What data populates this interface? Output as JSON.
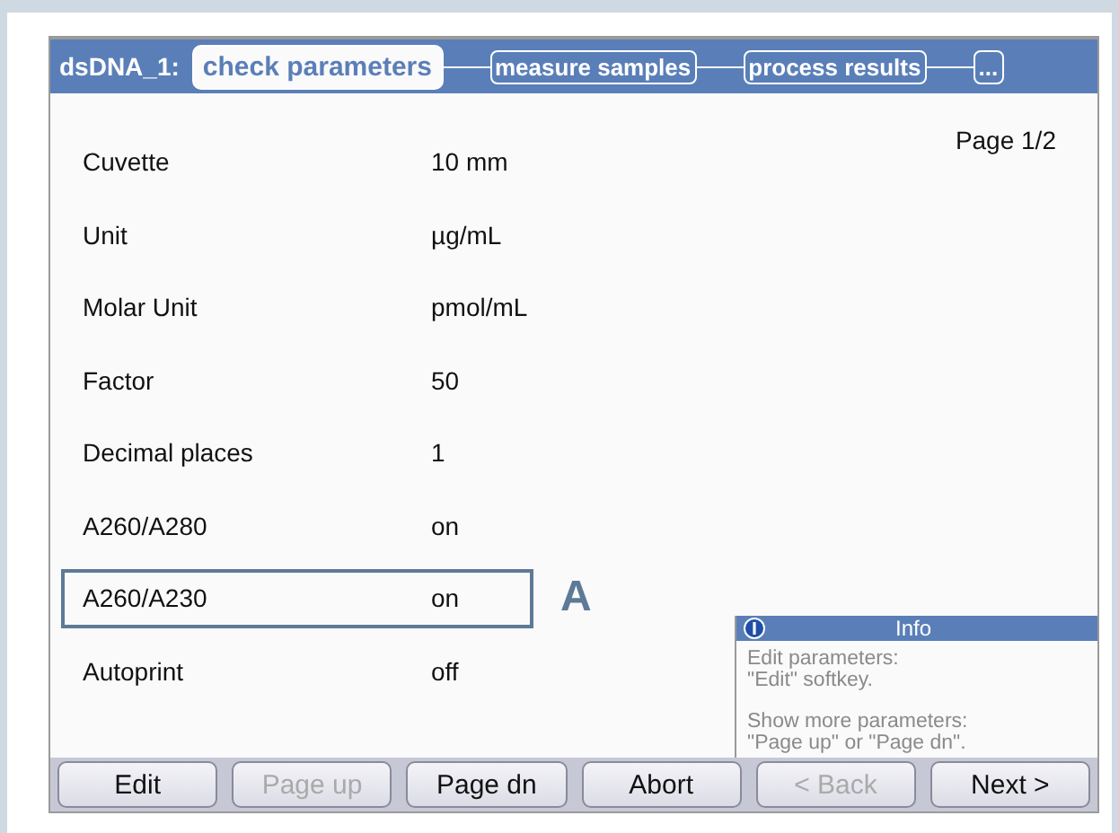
{
  "header": {
    "method": "dsDNA_1:",
    "steps": [
      {
        "label": "check parameters",
        "selected": true
      },
      {
        "label": "measure samples",
        "selected": false
      },
      {
        "label": "process results",
        "selected": false
      },
      {
        "label": "...",
        "selected": false
      }
    ]
  },
  "page_indicator": "Page 1/2",
  "parameters": [
    {
      "name": "Cuvette",
      "value": "10 mm",
      "selected": false
    },
    {
      "name": "Unit",
      "value": "µg/mL",
      "selected": false
    },
    {
      "name": "Molar Unit",
      "value": "pmol/mL",
      "selected": false
    },
    {
      "name": "Factor",
      "value": "50",
      "selected": false
    },
    {
      "name": "Decimal places",
      "value": "1",
      "selected": false
    },
    {
      "name": "A260/A280",
      "value": "on",
      "selected": false
    },
    {
      "name": "A260/A230",
      "value": "on",
      "selected": true
    },
    {
      "name": "Autoprint",
      "value": "off",
      "selected": false
    }
  ],
  "callout": "A",
  "info": {
    "title": "Info",
    "paragraphs": [
      [
        "Edit parameters:",
        "\"Edit\" softkey."
      ],
      [
        "Show more parameters:",
        "\"Page up\" or \"Page dn\"."
      ]
    ]
  },
  "softkeys": [
    {
      "label": "Edit",
      "disabled": false
    },
    {
      "label": "Page up",
      "disabled": true
    },
    {
      "label": "Page dn",
      "disabled": false
    },
    {
      "label": "Abort",
      "disabled": false
    },
    {
      "label": "< Back",
      "disabled": true
    },
    {
      "label": "Next >",
      "disabled": false
    }
  ]
}
